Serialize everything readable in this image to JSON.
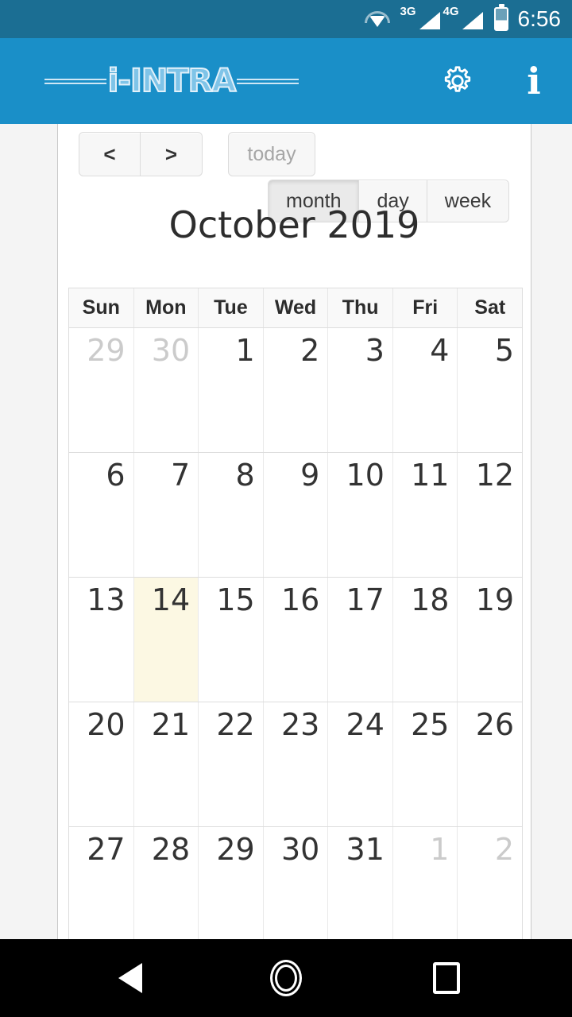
{
  "status_bar": {
    "wifi_icon": "wifi-icon",
    "signal_1_label": "3G",
    "signal_2_label": "4G",
    "battery_icon": "battery-icon",
    "time": "6:56",
    "background_color": "#1b6e93"
  },
  "app_bar": {
    "logo_text": "i-INTRA",
    "settings_icon": "gear-icon",
    "info_icon": "info-icon",
    "background_color": "#1a8fc8",
    "logo_color": "#7fc4e8"
  },
  "calendar": {
    "toolbar": {
      "prev_label": "<",
      "next_label": ">",
      "today_label": "today",
      "today_disabled": true,
      "views": [
        {
          "label": "month",
          "active": true
        },
        {
          "label": "day",
          "active": false
        },
        {
          "label": "week",
          "active": false
        }
      ]
    },
    "title": "October 2019",
    "day_headers": [
      "Sun",
      "Mon",
      "Tue",
      "Wed",
      "Thu",
      "Fri",
      "Sat"
    ],
    "today_highlight_color": "#fcf8e3",
    "weeks": [
      [
        {
          "num": "29",
          "other_month": true,
          "today": false
        },
        {
          "num": "30",
          "other_month": true,
          "today": false
        },
        {
          "num": "1",
          "other_month": false,
          "today": false
        },
        {
          "num": "2",
          "other_month": false,
          "today": false
        },
        {
          "num": "3",
          "other_month": false,
          "today": false
        },
        {
          "num": "4",
          "other_month": false,
          "today": false
        },
        {
          "num": "5",
          "other_month": false,
          "today": false
        }
      ],
      [
        {
          "num": "6",
          "other_month": false,
          "today": false
        },
        {
          "num": "7",
          "other_month": false,
          "today": false
        },
        {
          "num": "8",
          "other_month": false,
          "today": false
        },
        {
          "num": "9",
          "other_month": false,
          "today": false
        },
        {
          "num": "10",
          "other_month": false,
          "today": false
        },
        {
          "num": "11",
          "other_month": false,
          "today": false
        },
        {
          "num": "12",
          "other_month": false,
          "today": false
        }
      ],
      [
        {
          "num": "13",
          "other_month": false,
          "today": false
        },
        {
          "num": "14",
          "other_month": false,
          "today": true
        },
        {
          "num": "15",
          "other_month": false,
          "today": false
        },
        {
          "num": "16",
          "other_month": false,
          "today": false
        },
        {
          "num": "17",
          "other_month": false,
          "today": false
        },
        {
          "num": "18",
          "other_month": false,
          "today": false
        },
        {
          "num": "19",
          "other_month": false,
          "today": false
        }
      ],
      [
        {
          "num": "20",
          "other_month": false,
          "today": false
        },
        {
          "num": "21",
          "other_month": false,
          "today": false
        },
        {
          "num": "22",
          "other_month": false,
          "today": false
        },
        {
          "num": "23",
          "other_month": false,
          "today": false
        },
        {
          "num": "24",
          "other_month": false,
          "today": false
        },
        {
          "num": "25",
          "other_month": false,
          "today": false
        },
        {
          "num": "26",
          "other_month": false,
          "today": false
        }
      ],
      [
        {
          "num": "27",
          "other_month": false,
          "today": false
        },
        {
          "num": "28",
          "other_month": false,
          "today": false
        },
        {
          "num": "29",
          "other_month": false,
          "today": false
        },
        {
          "num": "30",
          "other_month": false,
          "today": false
        },
        {
          "num": "31",
          "other_month": false,
          "today": false
        },
        {
          "num": "1",
          "other_month": true,
          "today": false
        },
        {
          "num": "2",
          "other_month": true,
          "today": false
        }
      ]
    ]
  },
  "nav_bar": {
    "back_icon": "triangle-back-icon",
    "home_icon": "circle-home-icon",
    "recents_icon": "square-recents-icon",
    "background_color": "#000000"
  }
}
